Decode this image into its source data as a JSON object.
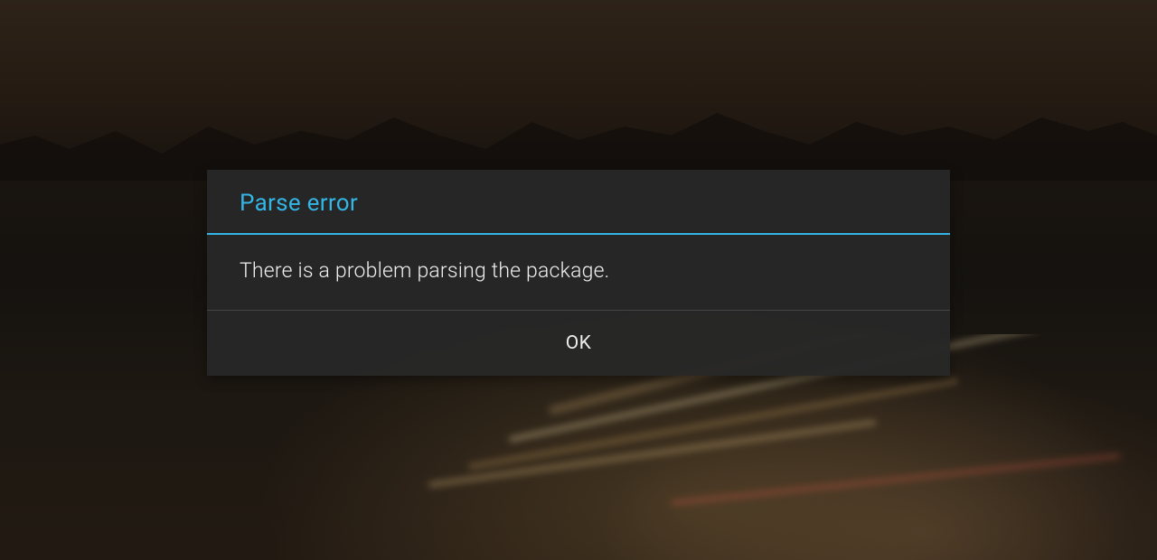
{
  "dialog": {
    "title": "Parse error",
    "message": "There is a problem parsing the package.",
    "actions": {
      "ok_label": "OK"
    },
    "accent_color": "#33b5e5"
  }
}
